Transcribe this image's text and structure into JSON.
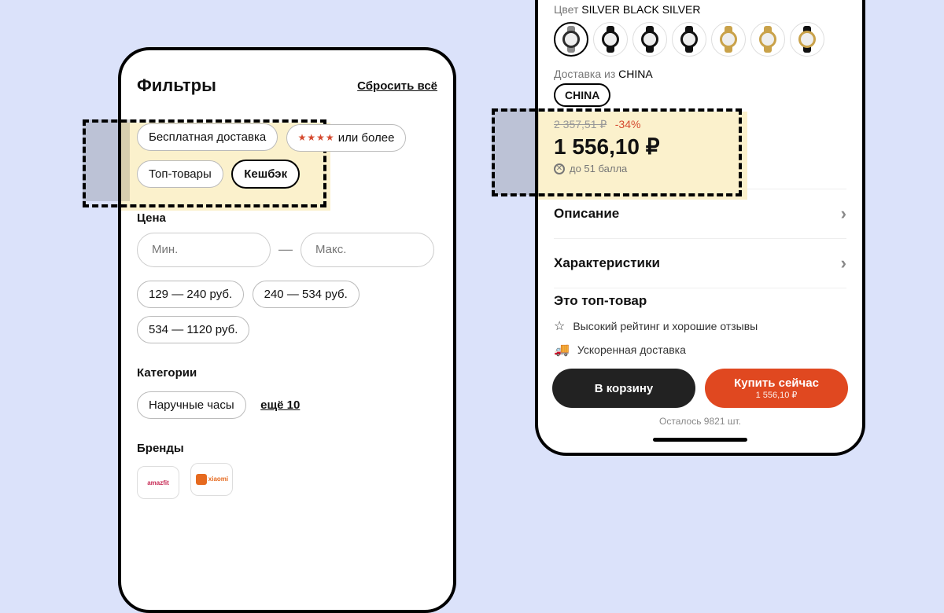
{
  "left": {
    "title": "Фильтры",
    "reset": "Сбросить всё",
    "chips": {
      "free_ship": "Бесплатная доставка",
      "stars_suffix": "или более",
      "top": "Топ-товары",
      "cashback": "Кешбэк"
    },
    "price": {
      "label": "Цена",
      "min_ph": "Мин.",
      "max_ph": "Макс.",
      "ranges": [
        "129 — 240 руб.",
        "240 — 534 руб.",
        "534 — 1120 руб."
      ]
    },
    "categories": {
      "label": "Категории",
      "items": [
        "Наручные часы"
      ],
      "more": "ещё 10"
    },
    "brands": {
      "label": "Бренды",
      "items": [
        "amazfit",
        "xiaomi"
      ]
    }
  },
  "right": {
    "color_label_prefix": "Цвет",
    "color_value": "SILVER BLACK SILVER",
    "swatches": [
      {
        "strap": "#8a8a8a",
        "bezel": "#2b2b2b",
        "sel": true
      },
      {
        "strap": "#111",
        "bezel": "#111"
      },
      {
        "strap": "#111",
        "bezel": "#111"
      },
      {
        "strap": "#111",
        "bezel": "#111"
      },
      {
        "strap": "#c9a24a",
        "bezel": "#c9a24a"
      },
      {
        "strap": "#c9a24a",
        "bezel": "#c9a24a"
      },
      {
        "strap": "#111",
        "bezel": "#c9a24a"
      }
    ],
    "ship_label_prefix": "Доставка из",
    "ship_value": "CHINA",
    "ship_pill": "CHINA",
    "price": {
      "old": "2 357,51 ₽",
      "discount": "-34%",
      "current": "1 556,10 ₽",
      "bonus": "до 51 балла"
    },
    "desc": "Описание",
    "specs": "Характеристики",
    "top_label": "Это топ-товар",
    "feat_rating": "Высокий рейтинг и хорошие отзывы",
    "feat_ship": "Ускоренная доставка",
    "btn_cart": "В корзину",
    "btn_buy": "Купить сейчас",
    "btn_buy_sub": "1 556,10 ₽",
    "stock": "Осталось 9821 шт."
  },
  "colors": {
    "accent_red": "#e04820",
    "highlight_bg": "#fbf0c7"
  }
}
